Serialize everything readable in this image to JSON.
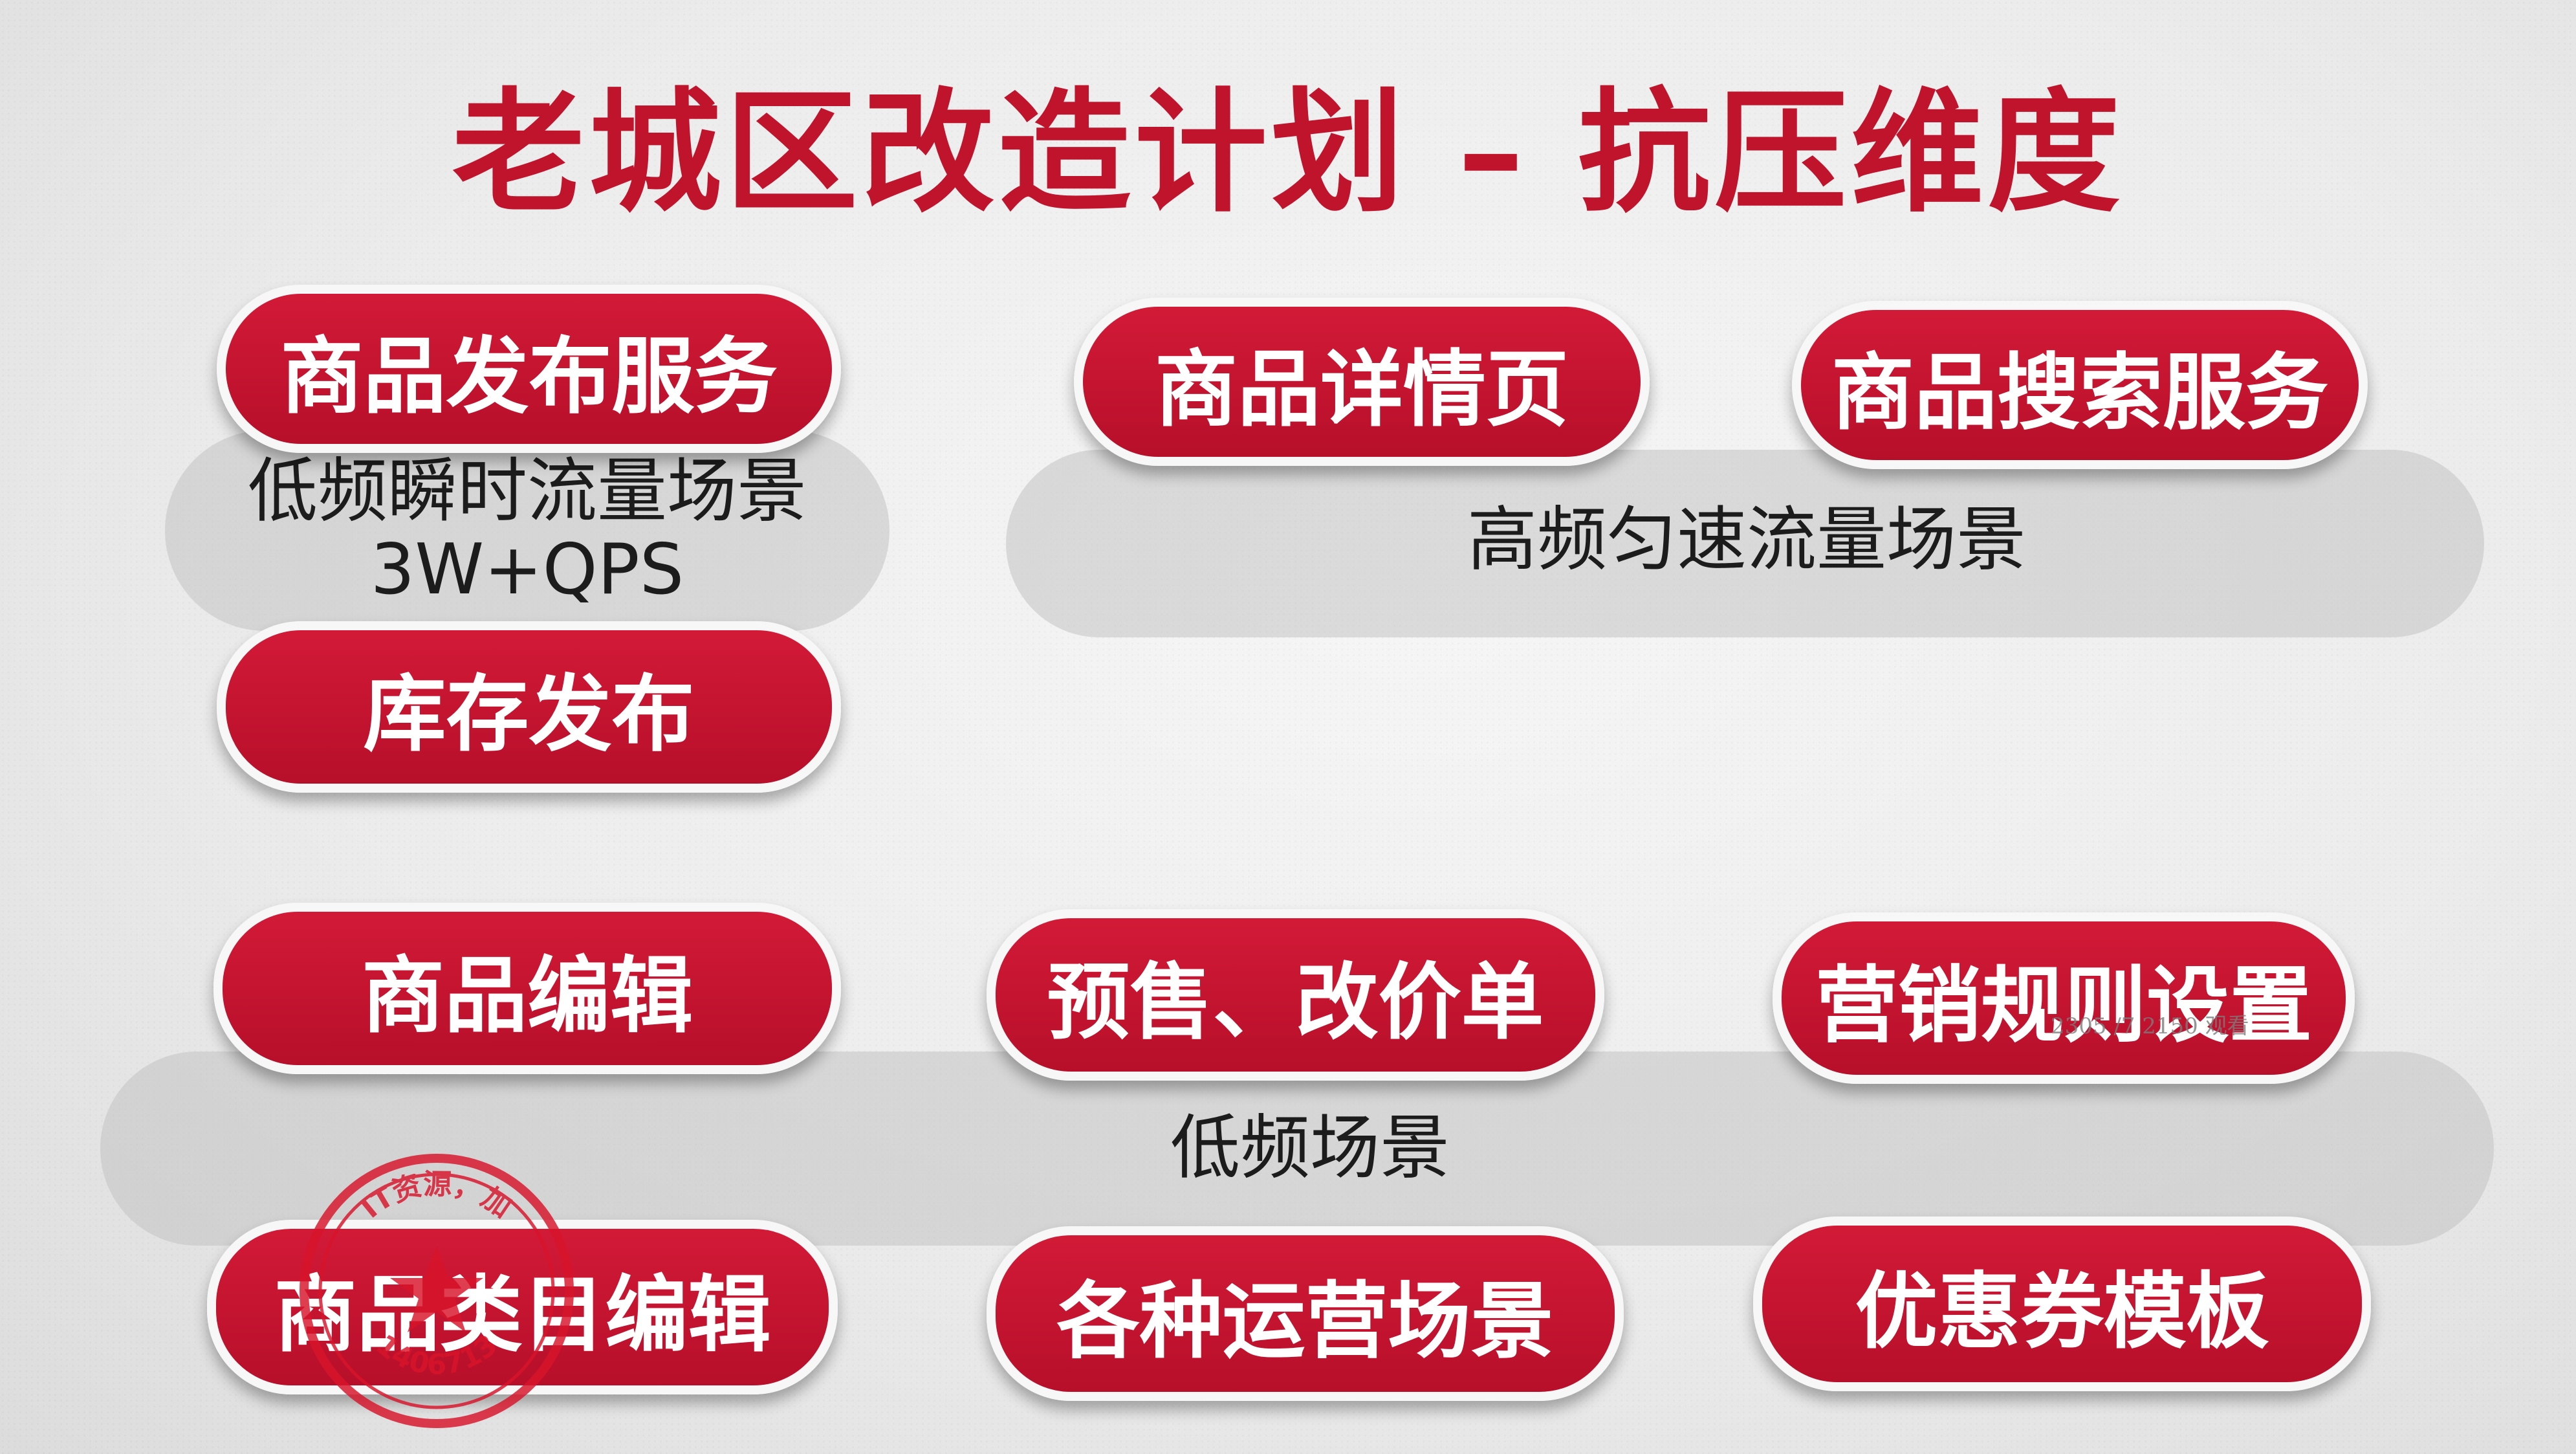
{
  "title": "老城区改造计划 – 抗压维度",
  "pills": {
    "publish_service": "商品发布服务",
    "detail_page": "商品详情页",
    "search_service": "商品搜索服务",
    "inventory_publish": "库存发布",
    "edit": "商品编辑",
    "presale": "预售、改价单",
    "marketing_rules": "营销规则设置",
    "category_edit": "商品类目编辑",
    "ops_scenes": "各种运营场景",
    "coupon_template": "优惠券模板"
  },
  "bands": {
    "low_burst_line1": "低频瞬时流量场景",
    "low_burst_line2": "3W+QPS",
    "high_steady": "高频匀速流量场景",
    "low_freq": "低频场景"
  },
  "overlay_text": "2305 /7 2150 观看",
  "colors": {
    "accent": "#c0142d",
    "pill": "#c8152f",
    "band": "#c3c3c3",
    "stamp": "#d8142a"
  },
  "stamp": {
    "top_text": "IT资源，加",
    "bottom_text": "1406713"
  }
}
